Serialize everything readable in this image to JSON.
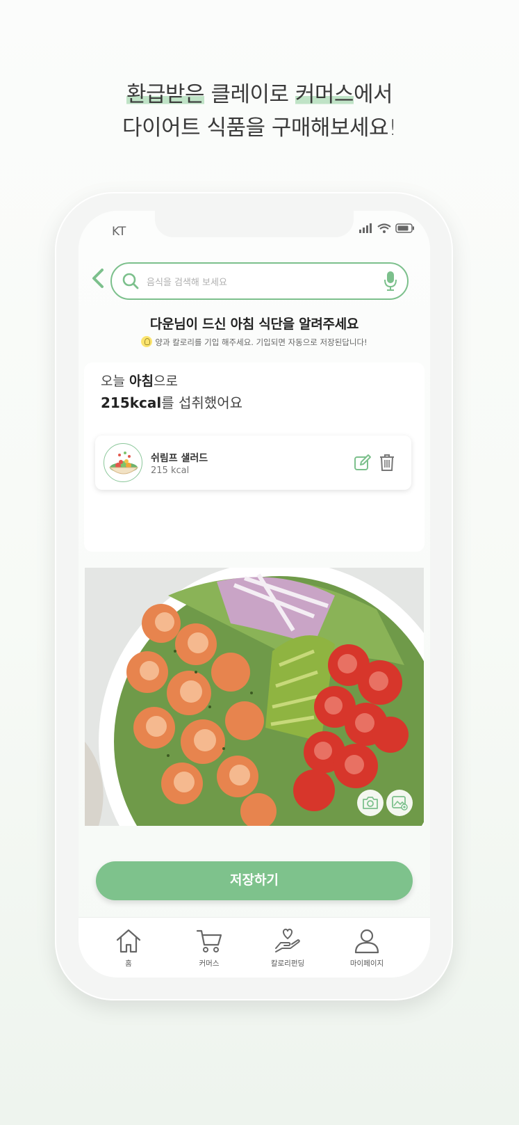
{
  "headline": {
    "line1_hl1": "환급받은",
    "line1_mid": " 클레이로 ",
    "line1_hl2": "커머스",
    "line1_end": "에서",
    "line2": "다이어트 식품을 구매해보세요!"
  },
  "status_bar": {
    "carrier": "KT"
  },
  "search": {
    "placeholder": "음식을 검색해 보세요"
  },
  "prompt": {
    "title": "다운님이 드신 아침 식단을 알려주세요",
    "subtitle": "양과 칼로리를 기입 해주세요. 기입되면 자동으로 저장된답니다!"
  },
  "summary": {
    "today": "오늘 ",
    "meal": "아침",
    "meal_suffix": "으로",
    "kcal": "215kcal",
    "kcal_suffix": "를 섭취했어요"
  },
  "food_items": [
    {
      "name": "쉬림프 샐러드",
      "kcal": "215 kcal"
    }
  ],
  "save_button": "저장하기",
  "tabs": [
    {
      "label": "홈",
      "icon": "home-icon"
    },
    {
      "label": "커머스",
      "icon": "cart-icon"
    },
    {
      "label": "칼로리펀딩",
      "icon": "heart-hand-icon"
    },
    {
      "label": "마이페이지",
      "icon": "person-icon"
    }
  ],
  "colors": {
    "accent": "#7ec28c",
    "highlight": "#bfe3c6"
  }
}
